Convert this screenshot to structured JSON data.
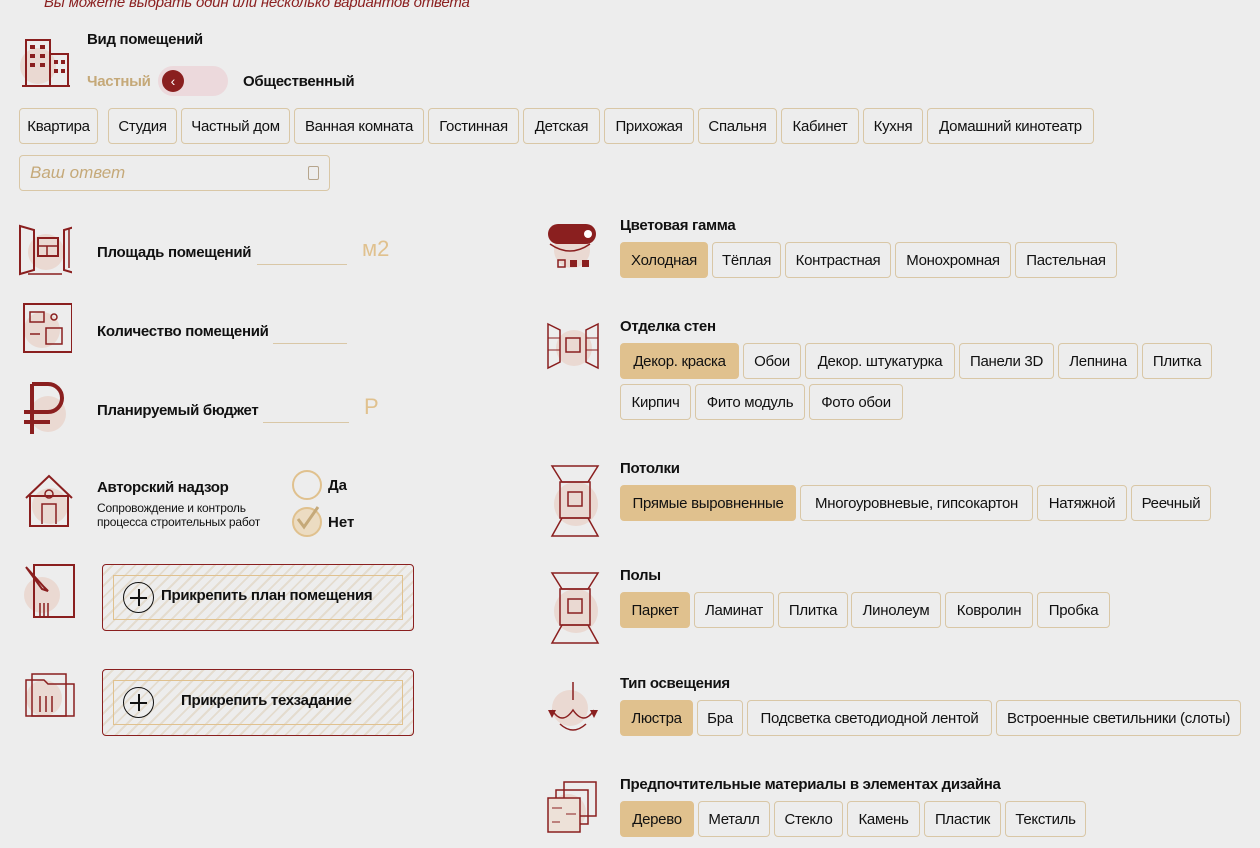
{
  "hint": "Вы можете выбрать один или несколько вариантов ответа",
  "room_type": {
    "title": "Вид помещений",
    "toggle_left": "Частный",
    "toggle_right": "Общественный",
    "options": [
      "Квартира",
      "Студия",
      "Частный дом",
      "Ванная комната",
      "Гостинная",
      "Детская",
      "Прихожая",
      "Спальня",
      "Кабинет",
      "Кухня",
      "Домашний кинотеатр"
    ],
    "answer_placeholder": "Ваш ответ"
  },
  "area": {
    "label": "Площадь помещений",
    "unit": "м2"
  },
  "count": {
    "label": "Количество помещений"
  },
  "budget": {
    "label": "Планируемый бюджет",
    "unit": "Р"
  },
  "supervision": {
    "label": "Авторский надзор",
    "desc_line1": "Сопровождение и контроль",
    "desc_line2": "процесса строительных работ",
    "yes": "Да",
    "no": "Нет",
    "selected": "Нет"
  },
  "attach_plan": {
    "label": "Прикрепить план помещения"
  },
  "attach_spec": {
    "label": "Прикрепить техзадание"
  },
  "color_scheme": {
    "title": "Цветовая гамма",
    "options": [
      "Холодная",
      "Тёплая",
      "Контрастная",
      "Монохромная",
      "Пастельная"
    ],
    "selected": "Холодная"
  },
  "walls": {
    "title": "Отделка стен",
    "options": [
      "Декор. краска",
      "Обои",
      "Декор. штукатурка",
      "Панели 3D",
      "Лепнина",
      "Плитка",
      "Кирпич",
      "Фито модуль",
      "Фото обои"
    ],
    "selected": "Декор. краска"
  },
  "ceilings": {
    "title": "Потолки",
    "options": [
      "Прямые выровненные",
      "Многоуровневые, гипсокартон",
      "Натяжной",
      "Реечный"
    ],
    "selected": "Прямые выровненные"
  },
  "floors": {
    "title": "Полы",
    "options": [
      "Паркет",
      "Ламинат",
      "Плитка",
      "Линолеум",
      "Ковролин",
      "Пробка"
    ],
    "selected": "Паркет"
  },
  "lighting": {
    "title": "Тип освещения",
    "options": [
      "Люстра",
      "Бра",
      "Подсветка светодиодной лентой",
      "Встроенные светильники (слоты)"
    ],
    "selected": "Люстра"
  },
  "materials": {
    "title": "Предпочтительные материалы в элементах дизайна",
    "options": [
      "Дерево",
      "Металл",
      "Стекло",
      "Камень",
      "Пластик",
      "Текстиль"
    ],
    "selected": "Дерево"
  },
  "colors": {
    "accent": "#8a1f1f",
    "chip_selected": "#e0c18e",
    "chip_border": "#d9c7a6",
    "background": "#ededed"
  }
}
